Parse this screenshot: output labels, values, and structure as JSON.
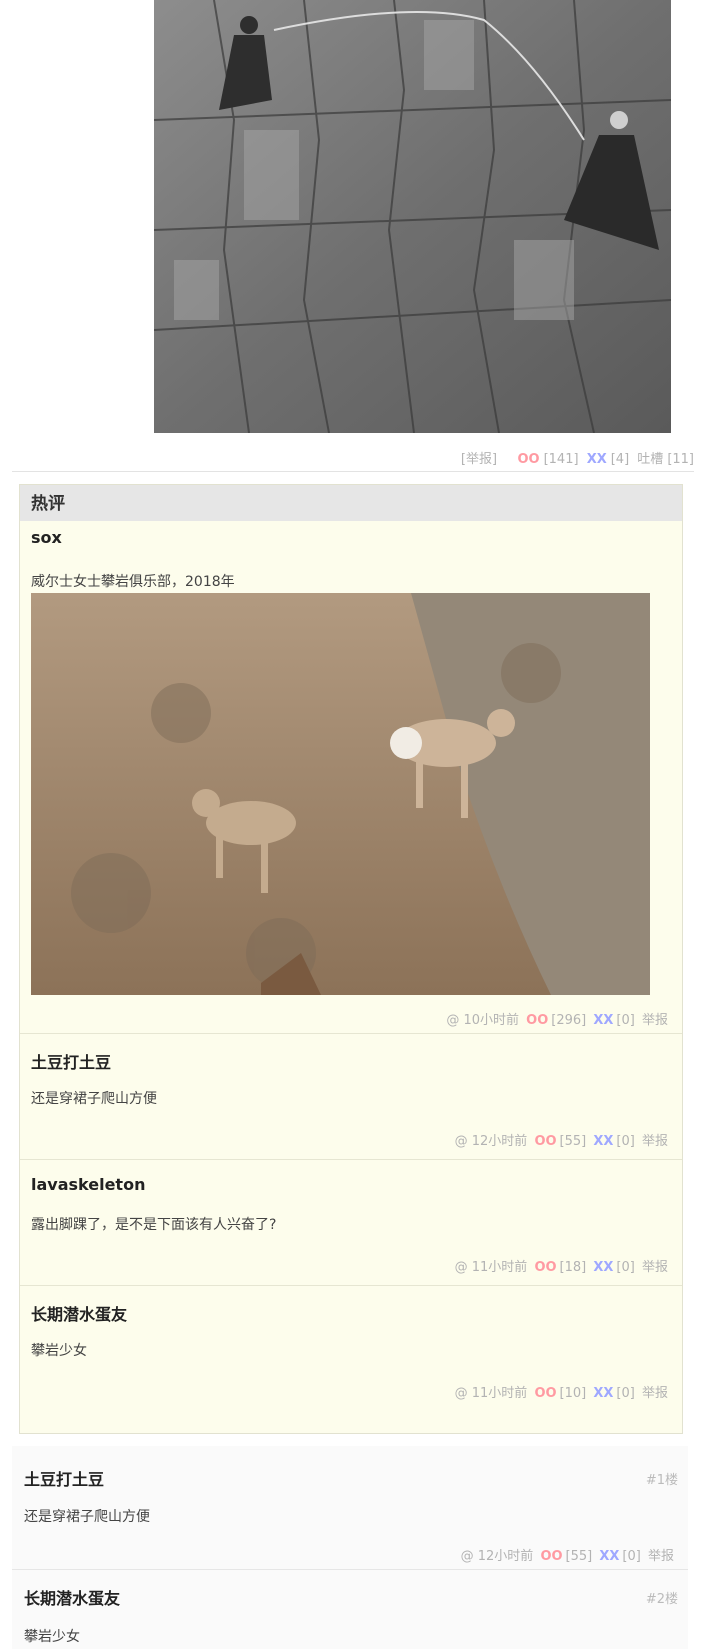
{
  "post": {
    "photo_alt": "climbers-photo",
    "actions": {
      "report": "[举报]",
      "oo_label": "OO",
      "oo_count": "[141]",
      "xx_label": "XX",
      "xx_count": "[4]",
      "tucao_label": "吐槽",
      "tucao_count": "[11]"
    }
  },
  "hot": {
    "title": "热评",
    "comments": [
      {
        "author": "sox",
        "text": "威尔士女士攀岩俱乐部，2018年",
        "time": "@ 10小时前",
        "oo": "OO",
        "oo_count": "[296]",
        "xx": "XX",
        "xx_count": "[0]",
        "report": "举报"
      },
      {
        "author": "土豆打土豆",
        "text": "还是穿裙子爬山方便",
        "time": "@ 12小时前",
        "oo": "OO",
        "oo_count": "[55]",
        "xx": "XX",
        "xx_count": "[0]",
        "report": "举报"
      },
      {
        "author": "lavaskeleton",
        "text": "露出脚踝了，是不是下面该有人兴奋了?",
        "time": "@ 11小时前",
        "oo": "OO",
        "oo_count": "[18]",
        "xx": "XX",
        "xx_count": "[0]",
        "report": "举报"
      },
      {
        "author": "长期潜水蛋友",
        "text": "攀岩少女",
        "time": "@ 11小时前",
        "oo": "OO",
        "oo_count": "[10]",
        "xx": "XX",
        "xx_count": "[0]",
        "report": "举报"
      }
    ]
  },
  "floors": [
    {
      "author": "土豆打土豆",
      "num": "#1楼",
      "text": "还是穿裙子爬山方便",
      "time": "@ 12小时前",
      "oo": "OO",
      "oo_count": "[55]",
      "xx": "XX",
      "xx_count": "[0]",
      "report": "举报"
    },
    {
      "author": "长期潜水蛋友",
      "num": "#2楼",
      "text": "攀岩少女"
    }
  ]
}
